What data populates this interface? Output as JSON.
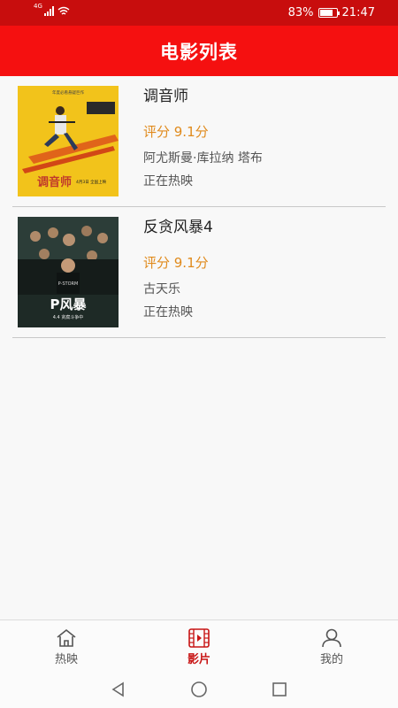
{
  "status_bar": {
    "network": "4G",
    "battery_percent": "83%",
    "battery_level": 0.83,
    "time": "21:47"
  },
  "app_bar": {
    "title": "电影列表"
  },
  "movies": [
    {
      "title": "调音师",
      "rating": "评分 9.1分",
      "actors": "阿尤斯曼·库拉纳 塔布",
      "status": "正在热映",
      "poster": {
        "text": "调音师",
        "tagline": "4月3日 全国上映",
        "top_text": "年度必看悬疑巨作"
      }
    },
    {
      "title": "反贪风暴4",
      "rating": "评分 9.1分",
      "actors": "古天乐",
      "status": "正在热映",
      "poster": {
        "text": "P风暴",
        "tagline": "4.4 贪腐斗争中",
        "top_text": "P-STORM"
      }
    }
  ],
  "tabs": [
    {
      "label": "热映",
      "icon": "home-icon",
      "active": false
    },
    {
      "label": "影片",
      "icon": "film-icon",
      "active": true
    },
    {
      "label": "我的",
      "icon": "person-icon",
      "active": false
    }
  ],
  "colors": {
    "status_bar": "#c80d0d",
    "app_bar": "#f51010",
    "rating": "#e08a1c",
    "active_tab": "#c81414"
  }
}
